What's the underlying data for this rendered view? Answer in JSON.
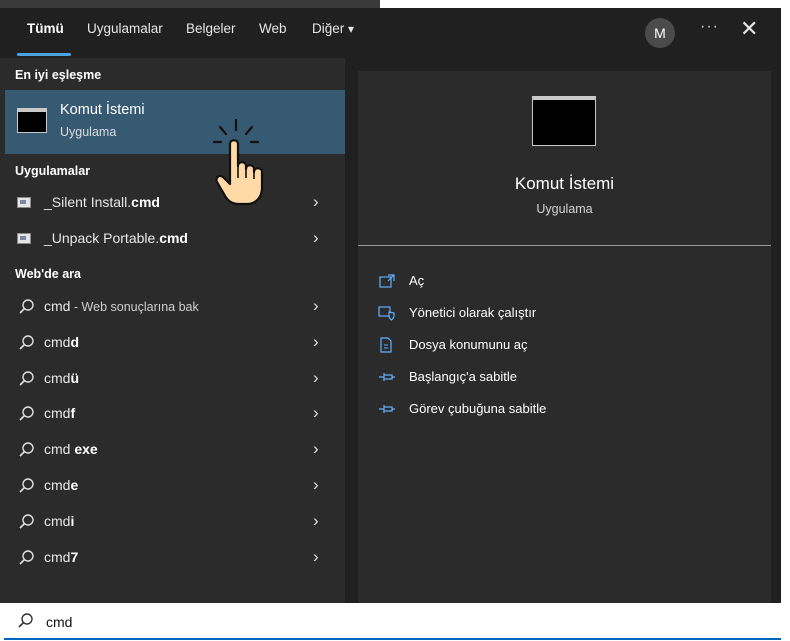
{
  "tabs": [
    {
      "label": "Tümü"
    },
    {
      "label": "Uygulamalar"
    },
    {
      "label": "Belgeler"
    },
    {
      "label": "Web"
    },
    {
      "label": "Diğer",
      "caret": "▾"
    }
  ],
  "header": {
    "avatar": "M",
    "more": "···",
    "close": "✕"
  },
  "left": {
    "best_match_heading": "En iyi eşleşme",
    "best_match": {
      "name": "Komut İstemi",
      "type": "Uygulama"
    },
    "apps_heading": "Uygulamalar",
    "apps": [
      {
        "prefix": "_Silent Install.",
        "bold": "cmd"
      },
      {
        "prefix": "_Unpack Portable.",
        "bold": "cmd"
      }
    ],
    "web_heading": "Web'de ara",
    "web_results": [
      {
        "prefix": "cmd",
        "bold": "",
        "hint": " - Web sonuçlarına bak"
      },
      {
        "prefix": "cmd",
        "bold": "d",
        "hint": ""
      },
      {
        "prefix": "cmd",
        "bold": "ü",
        "hint": ""
      },
      {
        "prefix": "cmd",
        "bold": "f",
        "hint": ""
      },
      {
        "prefix": "cmd",
        "bold": " exe",
        "hint": ""
      },
      {
        "prefix": "cmd",
        "bold": "e",
        "hint": ""
      },
      {
        "prefix": "cmd",
        "bold": "i",
        "hint": ""
      },
      {
        "prefix": "cmd",
        "bold": "7",
        "hint": ""
      }
    ],
    "chevron": "›"
  },
  "right": {
    "title": "Komut İstemi",
    "type": "Uygulama",
    "actions": [
      {
        "label": "Aç",
        "icon": "open-icon"
      },
      {
        "label": "Yönetici olarak çalıştır",
        "icon": "shield-icon"
      },
      {
        "label": "Dosya konumunu aç",
        "icon": "file-location-icon"
      },
      {
        "label": "Başlangıç'a sabitle",
        "icon": "pin-icon"
      },
      {
        "label": "Görev çubuğuna sabitle",
        "icon": "pin-icon"
      }
    ]
  },
  "search": {
    "value": "cmd"
  },
  "colors": {
    "accent": "#4aa3e6",
    "selected": "#375a73",
    "panel": "#202020",
    "surface": "#2b2b2b",
    "link": "#60b0ff"
  }
}
